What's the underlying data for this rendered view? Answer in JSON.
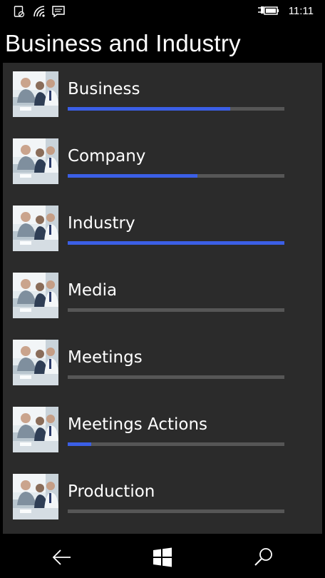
{
  "status": {
    "time": "11:11",
    "icons": [
      "do-not-disturb-icon",
      "wifi-icon",
      "message-icon",
      "battery-charging-icon"
    ]
  },
  "page": {
    "title": "Business and Industry"
  },
  "items": [
    {
      "label": "Business",
      "progress": 0.75,
      "thumbnail": "business-meeting-photo"
    },
    {
      "label": "Company",
      "progress": 0.6,
      "thumbnail": "business-meeting-photo"
    },
    {
      "label": "Industry",
      "progress": 1.0,
      "thumbnail": "business-meeting-photo"
    },
    {
      "label": "Media",
      "progress": 0.0,
      "thumbnail": "business-meeting-photo"
    },
    {
      "label": "Meetings",
      "progress": 0.0,
      "thumbnail": "business-meeting-photo"
    },
    {
      "label": "Meetings Actions",
      "progress": 0.11,
      "thumbnail": "business-meeting-photo"
    },
    {
      "label": "Production",
      "progress": 0.0,
      "thumbnail": "business-meeting-photo"
    }
  ],
  "navigation": {
    "buttons": [
      "back-arrow-icon",
      "windows-start-icon",
      "search-icon"
    ]
  },
  "colors": {
    "background": "#000000",
    "list_background": "#2b2b2b",
    "progress_fill": "#3b5fe6",
    "progress_track": "#565656"
  }
}
